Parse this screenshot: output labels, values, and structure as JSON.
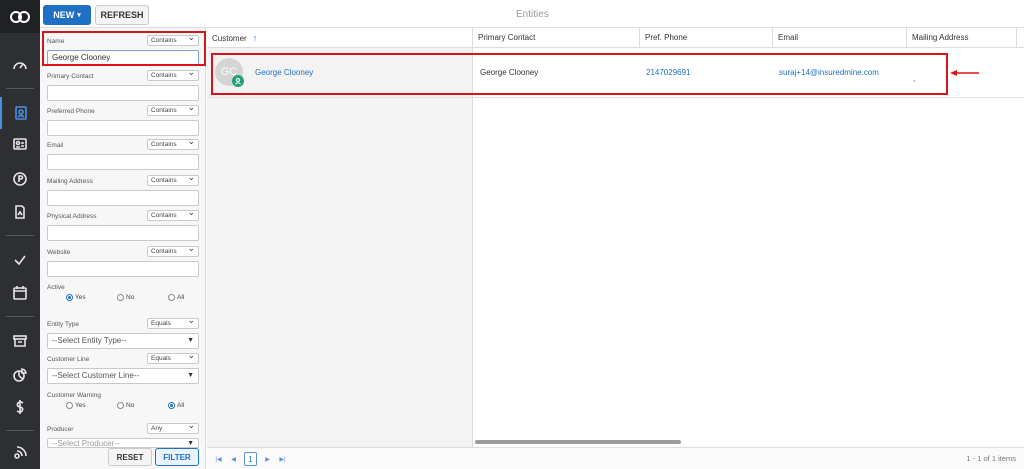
{
  "toolbar": {
    "new_label": "NEW",
    "refresh_label": "REFRESH",
    "page_title": "Entities"
  },
  "nav": {
    "icons": [
      "logo-icon",
      "dashboard-icon",
      "contacts-icon",
      "id-card-icon",
      "policy-icon",
      "documents-icon",
      "tasks-icon",
      "calendar-icon",
      "archive-icon",
      "reports-icon",
      "commission-icon",
      "integrations-icon"
    ]
  },
  "filters": {
    "name": {
      "label": "Name",
      "op": "Contains",
      "value": "George Clooney"
    },
    "primary_contact": {
      "label": "Primary Contact",
      "op": "Contains",
      "value": ""
    },
    "preferred_phone": {
      "label": "Preferred Phone",
      "op": "Contains",
      "value": ""
    },
    "email": {
      "label": "Email",
      "op": "Contains",
      "value": ""
    },
    "mailing_address": {
      "label": "Mailing Address",
      "op": "Contains",
      "value": ""
    },
    "physical_address": {
      "label": "Physical Address",
      "op": "Contains",
      "value": ""
    },
    "website": {
      "label": "Website",
      "op": "Contains",
      "value": ""
    },
    "active": {
      "label": "Active",
      "options": [
        "Yes",
        "No",
        "All"
      ],
      "selected": "Yes"
    },
    "entity_type": {
      "label": "Entity Type",
      "op": "Equals",
      "placeholder": "--Select Entity Type--"
    },
    "customer_line": {
      "label": "Customer Line",
      "op": "Equals",
      "placeholder": "--Select Customer Line--"
    },
    "customer_warning": {
      "label": "Customer Warning",
      "options": [
        "Yes",
        "No",
        "All"
      ],
      "selected": "All"
    },
    "producer": {
      "label": "Producer",
      "op": "Any",
      "placeholder": "--Select Producer--"
    },
    "reset_label": "RESET",
    "filter_label": "FILTER"
  },
  "grid": {
    "columns": [
      "Customer",
      "Primary Contact",
      "Pref. Phone",
      "Email",
      "Mailing Address"
    ],
    "rows": [
      {
        "initials": "GC",
        "customer": "George Clooney",
        "primary_contact": "George Clooney",
        "phone": "2147029691",
        "email": "suraj+14@insuredmine.com",
        "mailing_address": ","
      }
    ],
    "pager": {
      "page": "1",
      "info": "1 - 1 of 1 items"
    }
  }
}
